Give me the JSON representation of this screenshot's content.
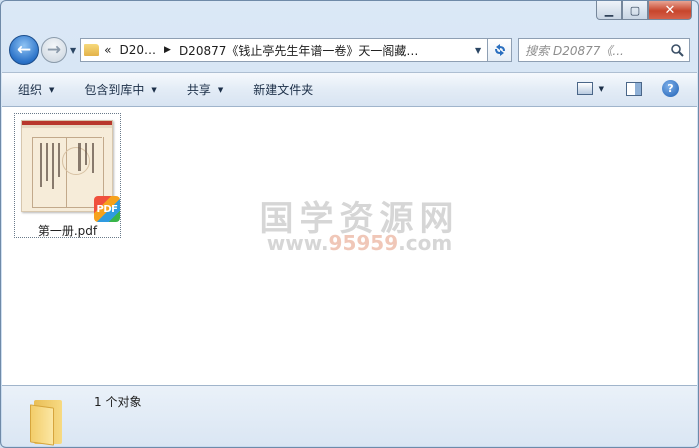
{
  "address": {
    "crumb_prefix": "«",
    "crumb_1": "D20…",
    "crumb_2": "D20877《钱止亭先生年谱一卷》天一阁藏…"
  },
  "search": {
    "placeholder": "搜索 D20877《..."
  },
  "toolbar": {
    "organize": "组织",
    "include_library": "包含到库中",
    "share": "共享",
    "new_folder": "新建文件夹"
  },
  "files": [
    {
      "name": "第一册.pdf",
      "badge": "PDF"
    }
  ],
  "watermark": {
    "main": "国学资源网",
    "sub_prefix": "www.",
    "sub_num": "95959",
    "sub_suffix": ".com"
  },
  "details": {
    "count": "1 个对象"
  },
  "colors": {
    "accent": "#2b72c8",
    "close": "#c7452c",
    "thumb_band": "#b8372c"
  }
}
